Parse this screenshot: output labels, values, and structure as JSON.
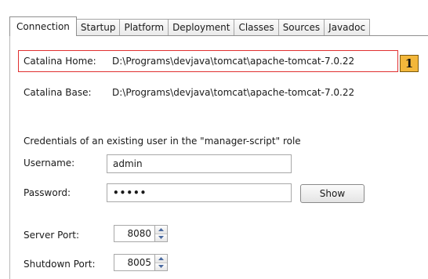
{
  "tabs": [
    {
      "label": "Connection",
      "active": true
    },
    {
      "label": "Startup"
    },
    {
      "label": "Platform"
    },
    {
      "label": "Deployment"
    },
    {
      "label": "Classes"
    },
    {
      "label": "Sources"
    },
    {
      "label": "Javadoc"
    }
  ],
  "connection": {
    "catalina_home_label": "Catalina Home:",
    "catalina_home_value": "D:\\Programs\\devjava\\tomcat\\apache-tomcat-7.0.22",
    "catalina_base_label": "Catalina Base:",
    "catalina_base_value": "D:\\Programs\\devjava\\tomcat\\apache-tomcat-7.0.22",
    "credentials_text": "Credentials of an existing user in the \"manager-script\" role",
    "username_label": "Username:",
    "username_value": "admin",
    "password_label": "Password:",
    "password_value": "•••••",
    "show_button": "Show",
    "server_port_label": "Server Port:",
    "server_port_value": "8080",
    "shutdown_port_label": "Shutdown Port:",
    "shutdown_port_value": "8005"
  },
  "annotation": {
    "badge": "1",
    "highlight_color": "#e03030",
    "badge_color": "#f3b73b"
  }
}
